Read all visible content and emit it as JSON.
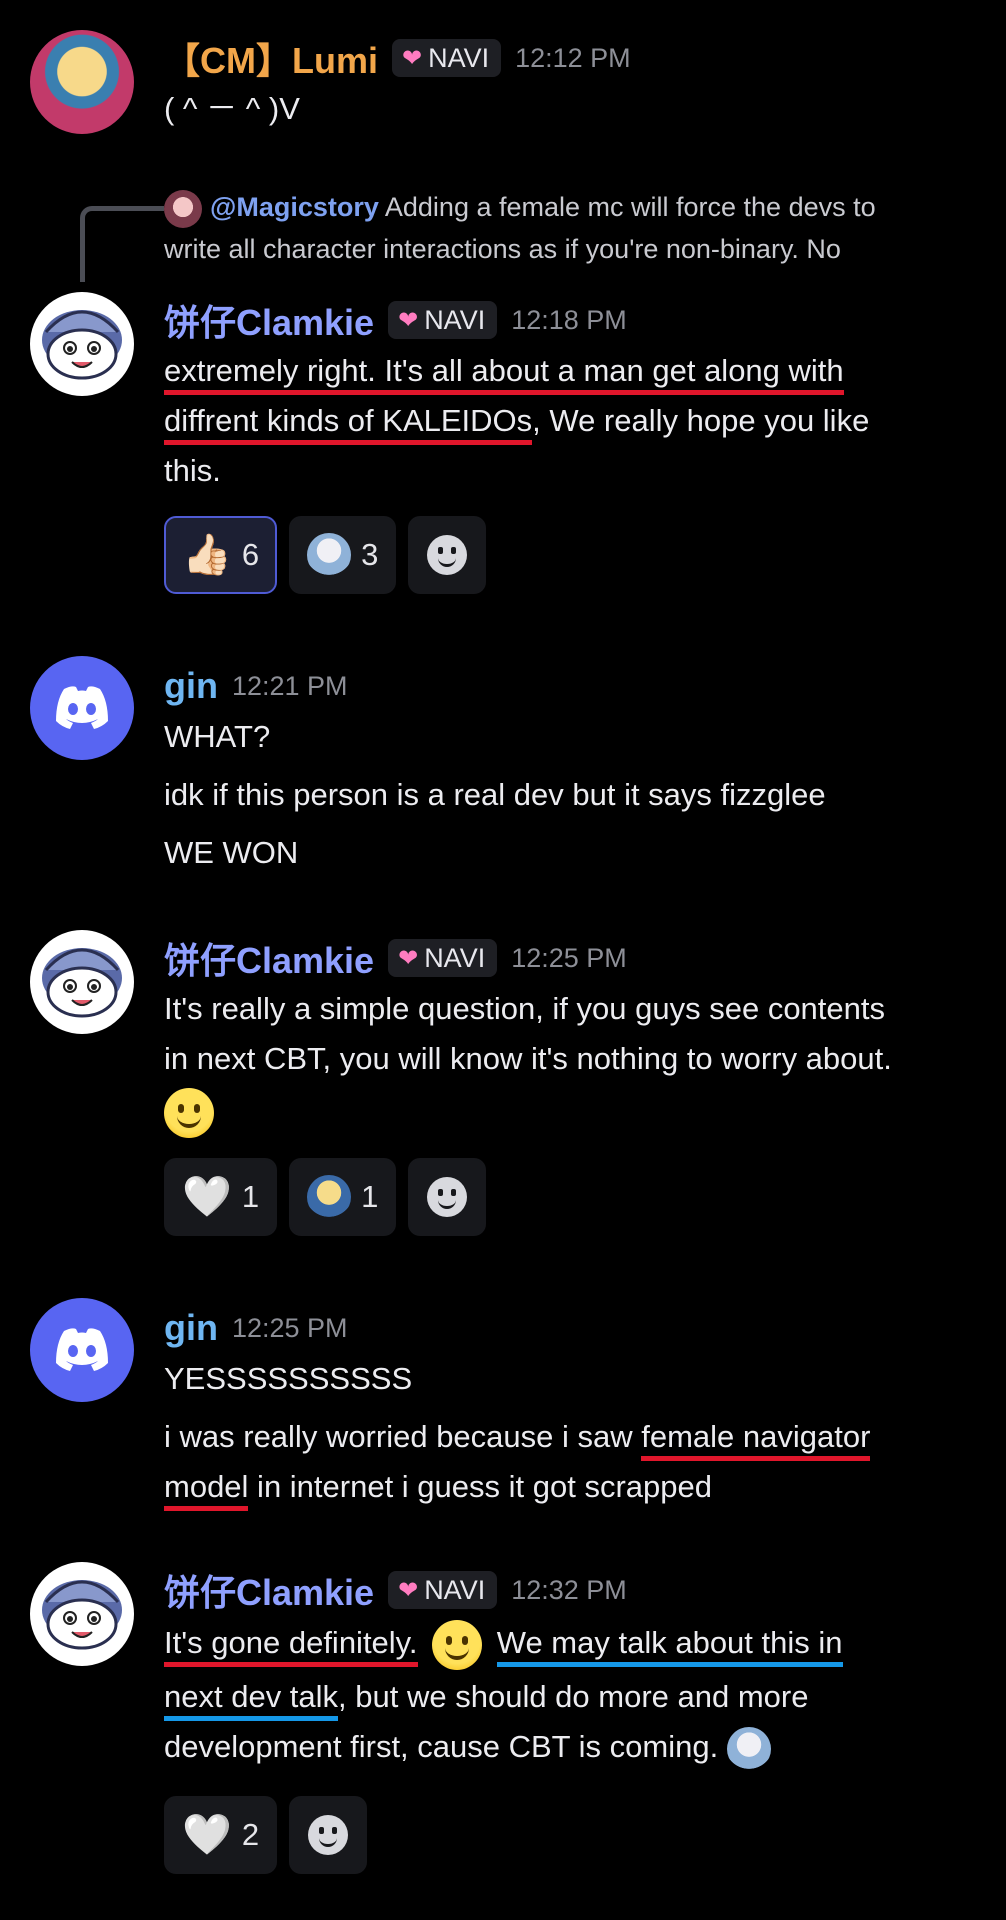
{
  "messages": [
    {
      "author": "【CM】Lumi",
      "badge": "NAVI",
      "time": "12:12 PM",
      "lines": [
        "( ^ － ^ )V"
      ]
    },
    {
      "reply": {
        "mention": "@Magicstory",
        "text_1": "Adding a female mc will force the devs to",
        "text_2": "write all character interactions as if you're non-binary. No"
      },
      "author": "饼仔Clamkie",
      "badge": "NAVI",
      "time": "12:18 PM",
      "lines": [
        "extremely right. It's all about a man get along with",
        "diffrent kinds of KALEIDOs",
        ", We really hope you like",
        "this."
      ],
      "reactions": [
        {
          "emoji": "👍🏻",
          "count": "6"
        },
        {
          "emoji": "chibi-sticker",
          "count": "3"
        }
      ]
    },
    {
      "author": "gin",
      "time": "12:21 PM",
      "lines": [
        "WHAT?",
        "idk if this person is a real dev but it says fizzglee",
        "WE WON"
      ]
    },
    {
      "author": "饼仔Clamkie",
      "badge": "NAVI",
      "time": "12:25 PM",
      "lines": [
        "It's really a simple question, if you guys see contents",
        "in next CBT, you will know it's nothing to worry about."
      ],
      "reactions": [
        {
          "emoji": "🤍",
          "count": "1"
        },
        {
          "emoji": "chibi-sticker",
          "count": "1"
        }
      ]
    },
    {
      "author": "gin",
      "time": "12:25 PM",
      "lines": [
        "YESSSSSSSSSS",
        "i was really worried because i saw ",
        "female navigator",
        "model",
        " in internet i guess it got scrapped"
      ]
    },
    {
      "author": "饼仔Clamkie",
      "badge": "NAVI",
      "time": "12:32 PM",
      "lines": [
        "It's gone definitely.",
        "We may talk about this in",
        "next dev talk",
        ", but we should do more and more",
        "development first, cause CBT is coming."
      ],
      "reactions": [
        {
          "emoji": "🤍",
          "count": "2"
        }
      ]
    }
  ],
  "icons": {
    "badge_icon": "pink-heart-icon",
    "add_reaction": "add-reaction-icon",
    "discord_avatar": "discord-logo-icon"
  },
  "colors": {
    "background": "#000000",
    "underline_red": "#e0162b",
    "underline_blue": "#1598e8",
    "clamkie_name": "#8fa0ff",
    "gin_name": "#6fb6f2",
    "lumi_name": "#f2a64a"
  }
}
